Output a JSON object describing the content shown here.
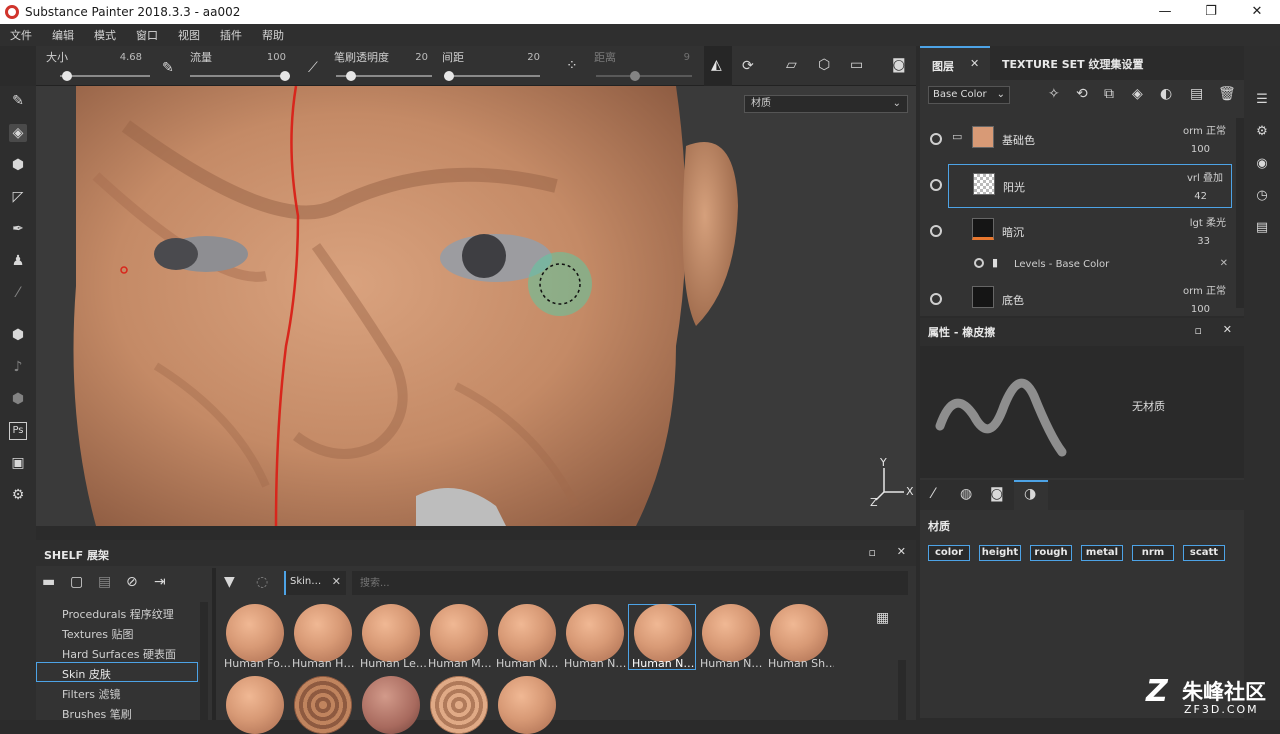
{
  "window": {
    "title": "Substance Painter 2018.3.3 - aa002",
    "min": "—",
    "restore": "❐",
    "close": "✕"
  },
  "menu": [
    "文件",
    "编辑",
    "模式",
    "窗口",
    "视图",
    "插件",
    "帮助"
  ],
  "toolbar": {
    "size_label": "大小",
    "size_value": "4.68",
    "flow_label": "流量",
    "flow_value": "100",
    "opacity_label": "笔刷透明度",
    "opacity_value": "20",
    "spacing_label": "间距",
    "spacing_value": "20",
    "distance_label": "距离",
    "distance_value": "9"
  },
  "viewport": {
    "material_select": "材质",
    "axis_y": "Y",
    "axis_z": "Z",
    "axis_x": "X"
  },
  "layers_panel": {
    "tab_layers": "图层",
    "tab_texture_set": "TEXTURE SET 纹理集设置",
    "channel_select": "Base Color",
    "layers": [
      {
        "name": "基础色",
        "blend": "orm 正常",
        "opacity": "100"
      },
      {
        "name": "阳光",
        "blend": "vrl 叠加",
        "opacity": "42"
      },
      {
        "name": "暗沉",
        "blend": "lgt 柔光",
        "opacity": "33"
      },
      {
        "name": "底色",
        "blend": "orm 正常",
        "opacity": "100"
      }
    ],
    "effect": "Levels - Base Color"
  },
  "properties": {
    "title": "属性 - 橡皮擦",
    "no_material": "无材质",
    "material_header": "材质",
    "channels": [
      "color",
      "height",
      "rough",
      "metal",
      "nrm",
      "scatt"
    ]
  },
  "shelf": {
    "title": "SHELF 展架",
    "filter_tag": "Skin…",
    "search_placeholder": "搜索...",
    "categories": [
      "Procedurals 程序纹理",
      "Textures 贴图",
      "Hard Surfaces 硬表面",
      "Skin 皮肤",
      "Filters 滤镜",
      "Brushes 笔刷"
    ],
    "items": [
      "Human Fo…",
      "Human H…",
      "Human Le…",
      "Human M…",
      "Human N…",
      "Human N…",
      "Human N…",
      "Human N…",
      "Human Sh…"
    ]
  },
  "watermark": {
    "main": "朱峰社区",
    "sub": "ZF3D.COM"
  }
}
